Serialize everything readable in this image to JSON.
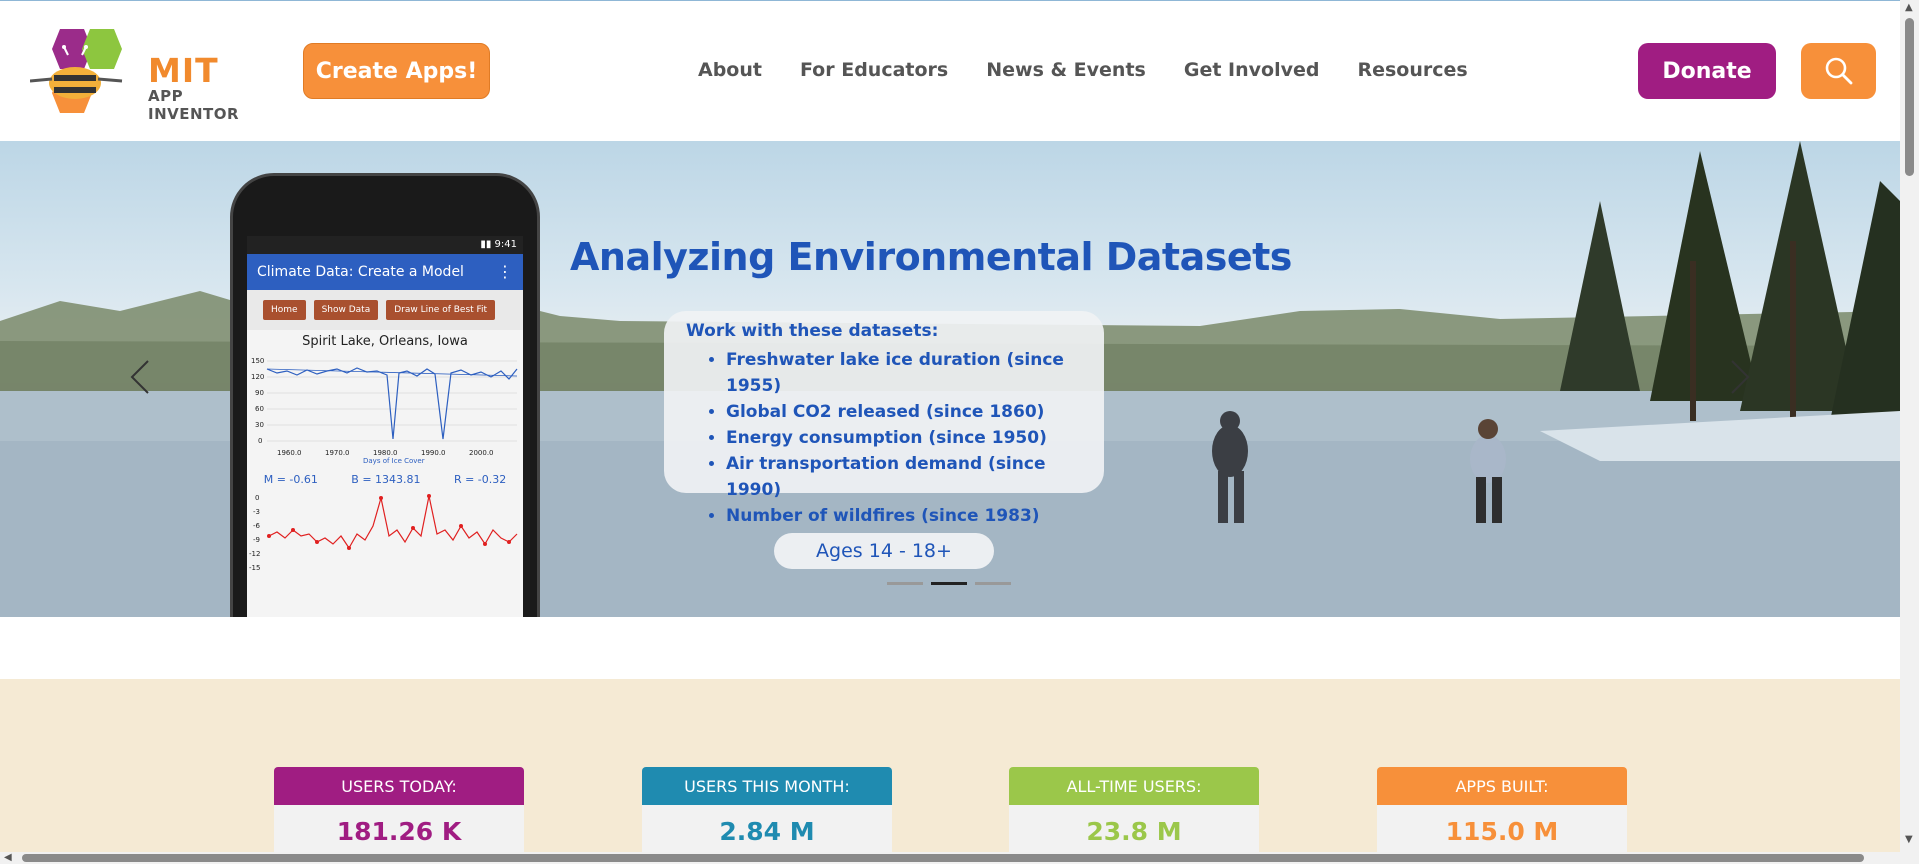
{
  "brand": {
    "name_line1": "MIT",
    "name_line2": "APP INVENTOR"
  },
  "header": {
    "create_label": "Create Apps!",
    "nav": [
      "About",
      "For Educators",
      "News & Events",
      "Get Involved",
      "Resources"
    ],
    "donate_label": "Donate"
  },
  "hero": {
    "title": "Analyzing Environmental Datasets",
    "datasets_heading": "Work with these datasets:",
    "datasets": [
      "Freshwater lake ice duration (since 1955)",
      "Global CO2 released (since 1860)",
      "Energy consumption (since 1950)",
      "Air transportation demand (since 1990)",
      "Number of wildfires (since 1983)"
    ],
    "ages": "Ages 14 - 18+",
    "slide_count": 3,
    "active_slide": 2,
    "phone": {
      "time": "9:41",
      "app_title": "Climate Data: Create a Model",
      "buttons": [
        "Home",
        "Show Data",
        "Draw Line of Best Fit"
      ],
      "chart_title": "Spirit Lake, Orleans, Iowa",
      "legend": "Days of Ice Cover",
      "x_ticks": [
        "1960.0",
        "1970.0",
        "1980.0",
        "1990.0",
        "2000.0"
      ],
      "y_ticks": [
        "150",
        "120",
        "90",
        "60",
        "30",
        "0"
      ],
      "stat_m": "M = -0.61",
      "stat_b": "B = 1343.81",
      "stat_r": "R = -0.32",
      "y2_ticks": [
        "0",
        "-3",
        "-6",
        "-9",
        "-12",
        "-15"
      ]
    }
  },
  "stats": [
    {
      "label": "USERS TODAY:",
      "value": "181.26 K",
      "color": "#a01d82"
    },
    {
      "label": "USERS THIS MONTH:",
      "value": "2.84 M",
      "color": "#1f8bb0"
    },
    {
      "label": "ALL-TIME USERS:",
      "value": "23.8 M",
      "color": "#9bc74a"
    },
    {
      "label": "APPS BUILT:",
      "value": "115.0 M",
      "color": "#f7903a"
    }
  ]
}
